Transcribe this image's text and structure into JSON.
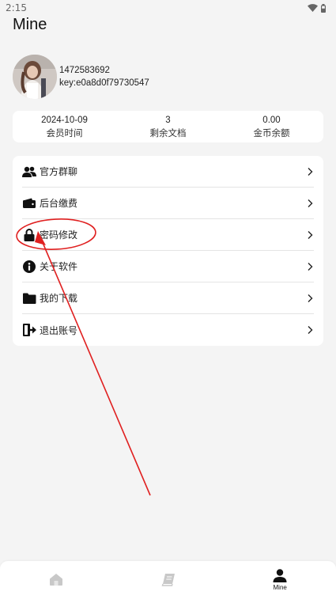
{
  "status_bar": {
    "time": "2:15",
    "wifi_icon": "wifi-icon",
    "battery_icon": "battery-icon"
  },
  "page": {
    "title": "Mine"
  },
  "profile": {
    "avatar_icon": "avatar-photo",
    "phone": "1472583692",
    "key": "key:e0a8d0f79730547"
  },
  "stats": [
    {
      "value": "2024-10-09",
      "label": "会员时间"
    },
    {
      "value": "3",
      "label": "剩余文档"
    },
    {
      "value": "0.00",
      "label": "金币余额"
    }
  ],
  "menu": [
    {
      "label": "官方群聊",
      "icon": "users-icon"
    },
    {
      "label": "后台缴费",
      "icon": "wallet-icon"
    },
    {
      "label": "密码修改",
      "icon": "lock-icon"
    },
    {
      "label": "关于软件",
      "icon": "info-icon"
    },
    {
      "label": "我的下载",
      "icon": "folder-icon"
    },
    {
      "label": "退出账号",
      "icon": "logout-icon"
    }
  ],
  "annotation": {
    "color": "#e02020",
    "highlighted_item": "密码修改"
  },
  "tabs": [
    {
      "icon": "home-icon",
      "label": ""
    },
    {
      "icon": "book-icon",
      "label": ""
    },
    {
      "icon": "person-icon",
      "label": "Mine"
    }
  ]
}
